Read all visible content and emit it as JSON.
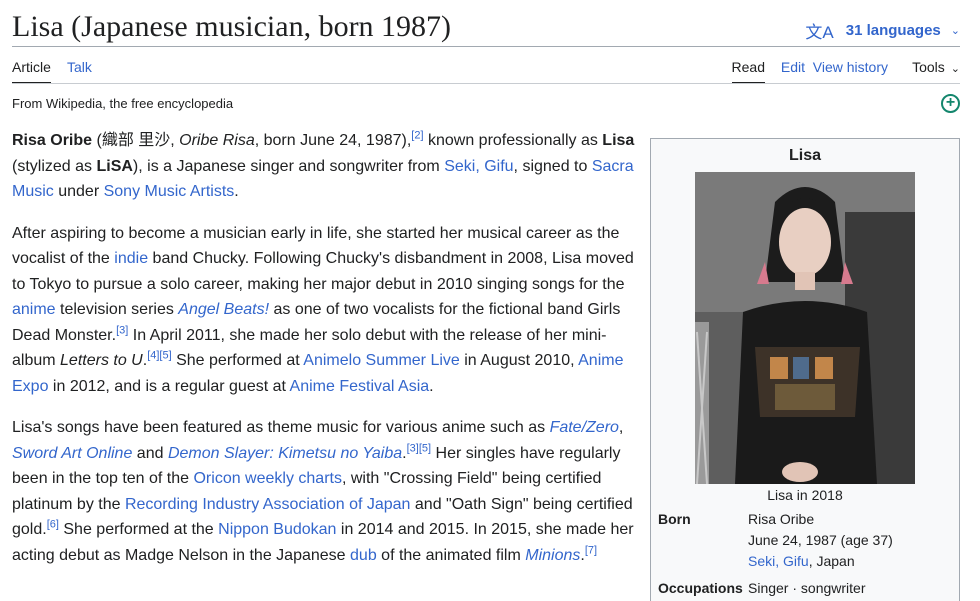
{
  "header": {
    "title": "Lisa (Japanese musician, born 1987)",
    "languages_label": "31 languages"
  },
  "tabs": {
    "article": "Article",
    "talk": "Talk",
    "read": "Read",
    "edit": "Edit",
    "history": "View history",
    "tools": "Tools"
  },
  "tagline": "From Wikipedia, the free encyclopedia",
  "body": {
    "p1": {
      "name_bold": "Risa Oribe",
      "native": "(織部 里沙, ",
      "romaji": "Oribe Risa",
      "born": ", born June 24, 1987),",
      "ref2": "[2]",
      "t1": " known professionally as ",
      "lisa_bold": "Lisa",
      "t2": " (stylized as ",
      "lisa_style": "LiSA",
      "t3": "), is a Japanese singer and songwriter from ",
      "seki_link": "Seki, Gifu",
      "t4": ", signed to ",
      "sacra_link": "Sacra Music",
      "t5": " under ",
      "sony_link": "Sony Music Artists",
      "t6": "."
    },
    "p2": {
      "t1": "After aspiring to become a musician early in life, she started her musical career as the vocalist of the ",
      "indie_link": "indie",
      "t2": " band Chucky. Following Chucky's disbandment in 2008, Lisa moved to Tokyo to pursue a solo career, making her major debut in 2010 singing songs for the ",
      "anime_link": "anime",
      "t3": " television series ",
      "angel_link": "Angel Beats!",
      "t4": " as one of two vocalists for the fictional band Girls Dead Monster.",
      "ref3": "[3]",
      "t5": " In April 2011, she made her solo debut with the release of her mini-album ",
      "letters": "Letters to U",
      "t6": ".",
      "ref4": "[4]",
      "ref5": "[5]",
      "t7": " She performed at ",
      "animelo_link": "Animelo Summer Live",
      "t8": " in August 2010, ",
      "expo_link": "Anime Expo",
      "t9": " in 2012, and is a regular guest at ",
      "afa_link": "Anime Festival Asia",
      "t10": "."
    },
    "p3": {
      "t1": "Lisa's songs have been featured as theme music for various anime such as ",
      "fate_link": "Fate/Zero",
      "t2": ", ",
      "sao_link": "Sword Art Online",
      "t3": " and ",
      "ds_link": "Demon Slayer: Kimetsu no Yaiba",
      "t4": ".",
      "ref3": "[3]",
      "ref5": "[5]",
      "t5": " Her singles have regularly been in the top ten of the ",
      "oricon_link": "Oricon weekly charts",
      "t6": ", with \"Crossing Field\" being certified platinum by the ",
      "riaj_link": "Recording Industry Association of Japan",
      "t7": " and \"Oath Sign\" being certified gold.",
      "ref6": "[6]",
      "t8": " She performed at the ",
      "budokan_link": "Nippon Budokan",
      "t9": " in 2014 and 2015. In 2015, she made her acting debut as Madge Nelson in the Japanese ",
      "dub_link": "dub",
      "t10": " of the animated film ",
      "minions_link": "Minions",
      "t11": ".",
      "ref7": "[7]"
    }
  },
  "infobox": {
    "title": "Lisa",
    "caption": "Lisa in 2018",
    "born_label": "Born",
    "born_name": "Risa Oribe",
    "born_date": "June 24, 1987 (age 37)",
    "born_place_link": "Seki, Gifu",
    "born_place_rest": ", Japan",
    "occupations_label": "Occupations",
    "occupations_value": "Singer · songwriter"
  },
  "colors": {
    "link": "#3366cc",
    "text": "#202122",
    "infobox_bg": "#f8f9fa",
    "add_icon": "#14866d"
  },
  "icons": {
    "language": "translate-icon",
    "chevron": "chevron-down-icon",
    "add": "add-circle-icon"
  }
}
